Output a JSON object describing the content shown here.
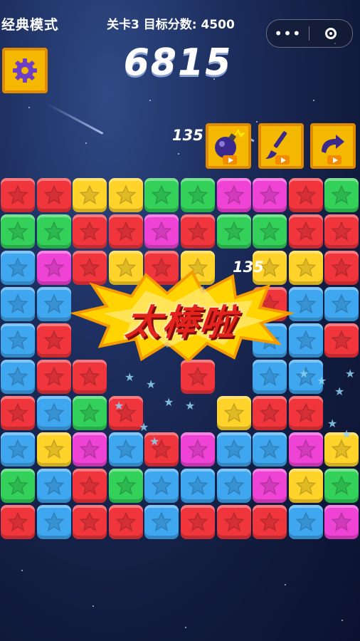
{
  "header": {
    "mode_title": "经典模式",
    "level_info": "关卡3 目标分数: 4500",
    "menu_more": "•••"
  },
  "score": {
    "current": "6815"
  },
  "floating_scores": [
    "135",
    "135"
  ],
  "tools": [
    {
      "name": "bomb",
      "icon": "bomb-icon"
    },
    {
      "name": "brush",
      "icon": "paintbrush-icon"
    },
    {
      "name": "refresh",
      "icon": "refresh-arrow-icon"
    }
  ],
  "celebration": {
    "text": "太棒啦"
  },
  "colors": {
    "R": "#f0353c",
    "G": "#33d05a",
    "Y": "#ffd32a",
    "B": "#3fa6f0",
    "P": "#ee43d4",
    "accent": "#f5b800"
  },
  "board": {
    "rows": [
      "RRYYGGPPRG",
      "GGRRPRGGRR",
      "BPRYRY.YYR",
      "BB.....RBB",
      "BR.....BBR",
      "BRR..R.BB.",
      "RBGR..YRR.",
      "BYPBRPBBPY",
      "GBRGBBBPYG",
      "RBRRBRRRBP"
    ]
  }
}
